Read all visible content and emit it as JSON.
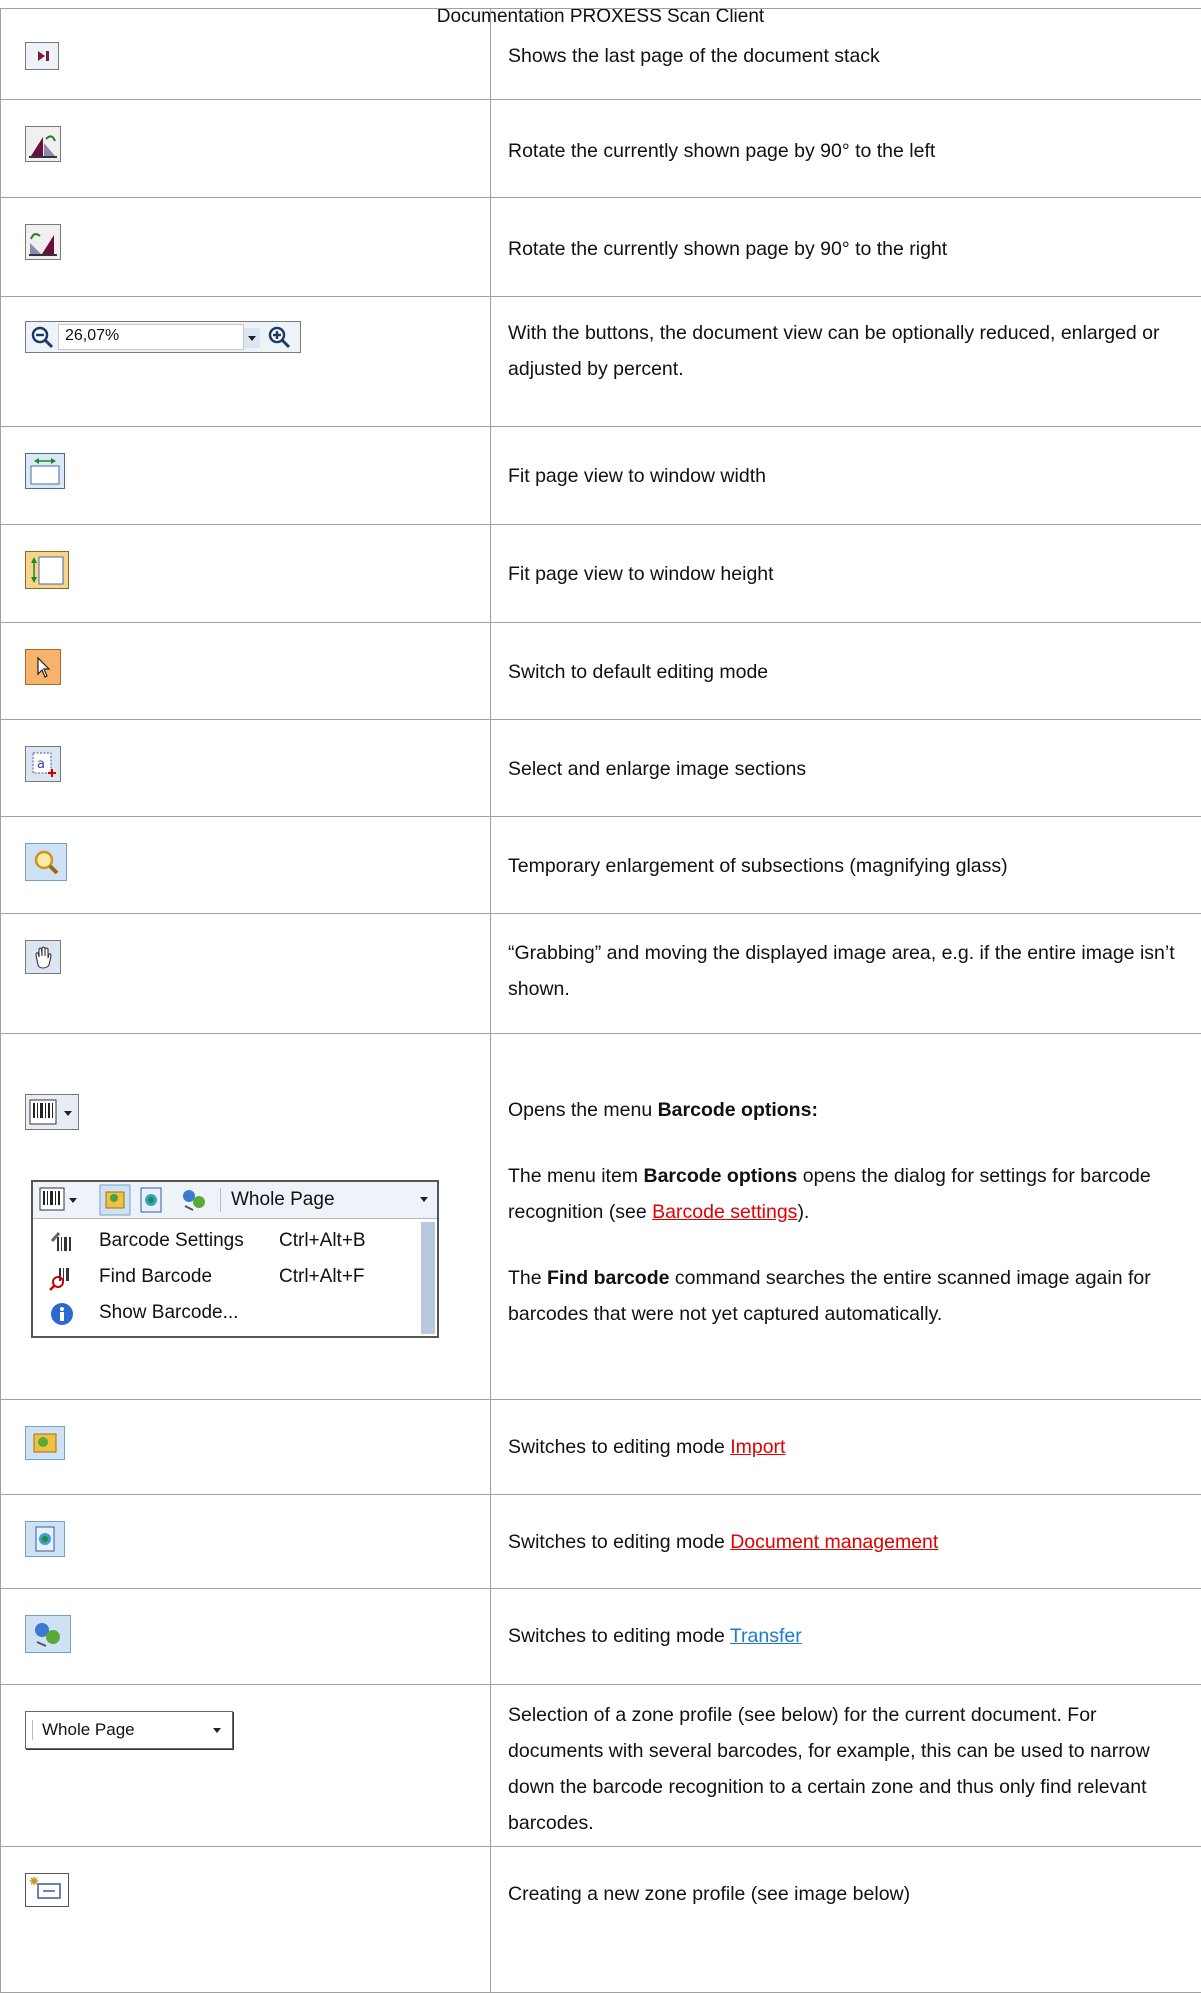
{
  "header": {
    "title": "Documentation PROXESS Scan Client"
  },
  "rows": [
    {
      "icon": "last-page-icon",
      "text": "Shows the last page of the document stack"
    },
    {
      "icon": "rotate-left-icon",
      "text": "Rotate the currently shown page by 90° to the left"
    },
    {
      "icon": "rotate-right-icon",
      "text": "Rotate the currently shown page by 90° to the right"
    },
    {
      "icon": "zoom-bar",
      "zoom_value": "26,07%",
      "text": "With the buttons, the document view can be optionally reduced, enlarged or adjusted by percent."
    },
    {
      "icon": "fit-width-icon",
      "text": "Fit page view to window width"
    },
    {
      "icon": "fit-height-icon",
      "text": "Fit page view to window height"
    },
    {
      "icon": "pointer-icon",
      "text": "Switch to default editing mode"
    },
    {
      "icon": "select-enlarge-icon",
      "text": "Select and enlarge image sections"
    },
    {
      "icon": "magnifier-icon",
      "text": "Temporary enlargement of subsections (magnifying glass)"
    },
    {
      "icon": "hand-icon",
      "text": "“Grabbing” and moving the displayed image area, e.g. if the entire image isn’t shown."
    },
    {
      "icon": "barcode-dropdown-icon",
      "p1_prefix": "Opens the menu ",
      "p1_bold": "Barcode options:",
      "p2_prefix": "The menu item ",
      "p2_bold": "Barcode options",
      "p2_mid": " opens the dialog for settings for barcode recognition (see ",
      "p2_link": "Barcode settings",
      "p2_suffix": ").",
      "p3_prefix": "The ",
      "p3_bold": "Find barcode",
      "p3_suffix": " command searches the entire scanned image again for barcodes that were not yet captured automatically.",
      "menu": {
        "dropdown_value": "Whole Page",
        "items": [
          {
            "icon": "barcode-settings-icon",
            "label": "Barcode Settings",
            "shortcut": "Ctrl+Alt+B"
          },
          {
            "icon": "find-barcode-icon",
            "label": "Find Barcode",
            "shortcut": "Ctrl+Alt+F"
          },
          {
            "icon": "info-icon",
            "label": "Show Barcode...",
            "shortcut": ""
          }
        ]
      }
    },
    {
      "icon": "import-mode-icon",
      "prefix": "Switches to editing mode ",
      "link": "Import",
      "link_color": "#e00000"
    },
    {
      "icon": "document-management-icon",
      "prefix": "Switches to editing mode ",
      "link": "Document management",
      "link_color": "#e00000"
    },
    {
      "icon": "transfer-mode-icon",
      "prefix": "Switches to editing mode ",
      "link": "Transfer",
      "link_color": "#1a7bd0"
    },
    {
      "icon": "zone-profile-select",
      "select_value": "Whole Page",
      "text": "Selection of a zone profile (see below) for the current document. For documents with several barcodes, for example, this can be used to narrow down the barcode recognition to a certain zone and thus only find relevant barcodes."
    },
    {
      "icon": "new-zone-profile-icon",
      "text": "Creating a new zone profile (see image below)"
    }
  ]
}
